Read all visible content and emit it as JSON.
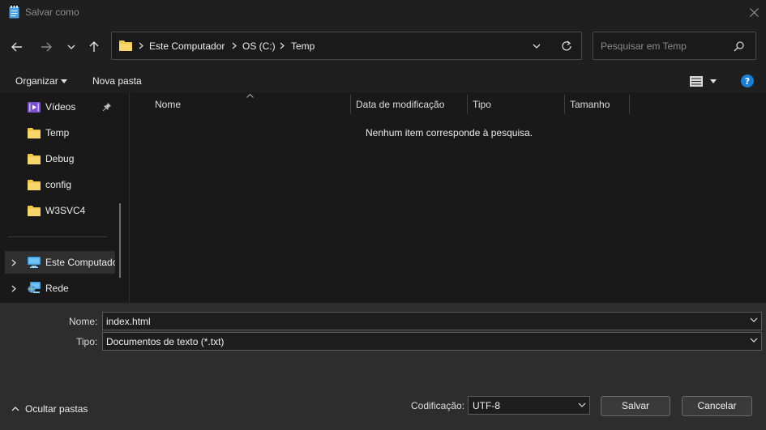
{
  "window": {
    "title": "Salvar como"
  },
  "address": {
    "crumbs": [
      "Este Computador",
      "OS (C:)",
      "Temp"
    ],
    "search_placeholder": "Pesquisar em Temp"
  },
  "toolbar": {
    "organize": "Organizar",
    "new_folder": "Nova pasta"
  },
  "sidebar": {
    "items": [
      {
        "label": "Vídeos",
        "icon": "videos-folder-icon",
        "pinned": true
      },
      {
        "label": "Temp",
        "icon": "folder-icon"
      },
      {
        "label": "Debug",
        "icon": "folder-icon"
      },
      {
        "label": "config",
        "icon": "folder-icon"
      },
      {
        "label": "W3SVC4",
        "icon": "folder-icon"
      }
    ],
    "roots": [
      {
        "label": "Este Computador",
        "icon": "computer-icon"
      },
      {
        "label": "Rede",
        "icon": "network-icon"
      }
    ]
  },
  "columns": [
    "Nome",
    "Data de modificação",
    "Tipo",
    "Tamanho"
  ],
  "empty_message": "Nenhum item corresponde à pesquisa.",
  "form": {
    "name_label": "Nome:",
    "name_value": "index.html",
    "type_label": "Tipo:",
    "type_value": "Documentos de texto (*.txt)",
    "encoding_label": "Codificação:",
    "encoding_value": "UTF-8"
  },
  "footer": {
    "hide_folders": "Ocultar pastas",
    "save": "Salvar",
    "cancel": "Cancelar"
  },
  "colors": {
    "folder": "#f2c94c",
    "accent": "#0078d4",
    "help": "#1a7fd6"
  }
}
